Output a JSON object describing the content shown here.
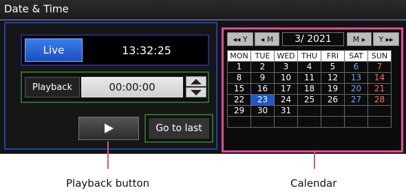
{
  "window": {
    "title": "Date & Time"
  },
  "live": {
    "label": "Live",
    "time": "13:32:25"
  },
  "playback": {
    "label": "Playback",
    "time": "00:00:00"
  },
  "controls": {
    "go_to_last": "Go to last"
  },
  "calendar": {
    "nav": {
      "prev_year": "◂◂ Y",
      "prev_month": "◂ M",
      "month_year": "3/ 2021",
      "next_month": "M ▸",
      "next_year": "Y ▸▸"
    },
    "weekdays": [
      "MON",
      "TUE",
      "WED",
      "THU",
      "FRI",
      "SAT",
      "SUN"
    ],
    "weeks": [
      [
        "1",
        "2",
        "3",
        "4",
        "5",
        "6",
        "7"
      ],
      [
        "8",
        "9",
        "10",
        "11",
        "12",
        "13",
        "14"
      ],
      [
        "15",
        "16",
        "17",
        "18",
        "19",
        "20",
        "21"
      ],
      [
        "22",
        "23",
        "24",
        "25",
        "26",
        "27",
        "28"
      ],
      [
        "29",
        "30",
        "31",
        "",
        "",
        "",
        ""
      ],
      [
        "",
        "",
        "",
        "",
        "",
        "",
        ""
      ]
    ],
    "selected_day": "23"
  },
  "callouts": {
    "playback_button": "Playback button",
    "calendar": "Calendar"
  },
  "colors": {
    "accent": "#e64b97",
    "live": "#1c4fc0",
    "selected": "#1f57c9"
  }
}
